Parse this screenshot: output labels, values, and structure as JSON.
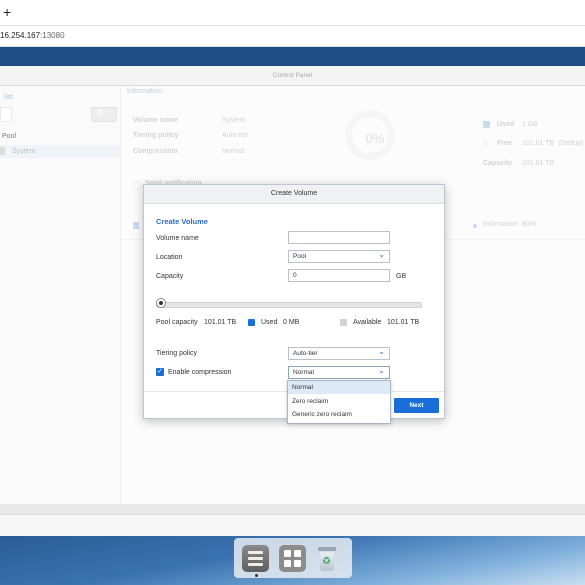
{
  "browser": {
    "new_tab_label": "+",
    "url_host": "16.254.167",
    "url_port": ":13080"
  },
  "control_panel": {
    "title": "Control Panel"
  },
  "left_pane": {
    "list_title": "list",
    "pool_label": "Pool",
    "system_item": "System"
  },
  "info": {
    "section_title": "Information",
    "rows": [
      {
        "label": "Volume name",
        "value": "System"
      },
      {
        "label": "Tiering policy",
        "value": "Auto-tier"
      },
      {
        "label": "Compression",
        "value": "Normal"
      }
    ],
    "donut_value": "0%",
    "used_label": "Used",
    "used_value": "1 GB",
    "free_label": "Free",
    "free_value": "101.01 TB  (Dedup)",
    "capacity_label": "Capacity",
    "capacity_value": "101.01 TB",
    "partial_text": "Send notification",
    "info_legend": "Information  80%"
  },
  "modal": {
    "title": "Create Volume",
    "section_heading": "Create Volume",
    "volume_name_label": "Volume name",
    "volume_name_value": "",
    "location_label": "Location",
    "location_value": "Pool",
    "capacity_label": "Capacity",
    "capacity_value": "0",
    "capacity_unit": "GB",
    "slider_level_percent": 0,
    "pool_capacity_label": "Pool capacity",
    "pool_capacity_value": "101.01 TB",
    "used_label": "Used",
    "used_value": "0 MB",
    "available_label": "Available",
    "available_value": "101.01 TB",
    "tiering_label": "Tiering policy",
    "tiering_value": "Auto-tier",
    "compression_label": "Enable compression",
    "compression_checked": true,
    "compression_value": "Normal",
    "compression_options": [
      "Normal",
      "Zero reclaim",
      "Generic zero reclaim"
    ],
    "next_label": "Next"
  },
  "colors": {
    "accent": "#1a6ed8",
    "header_band": "#1d4f86",
    "used_dot": "#1a6ed8",
    "available_dot": "#d3d3d3"
  }
}
